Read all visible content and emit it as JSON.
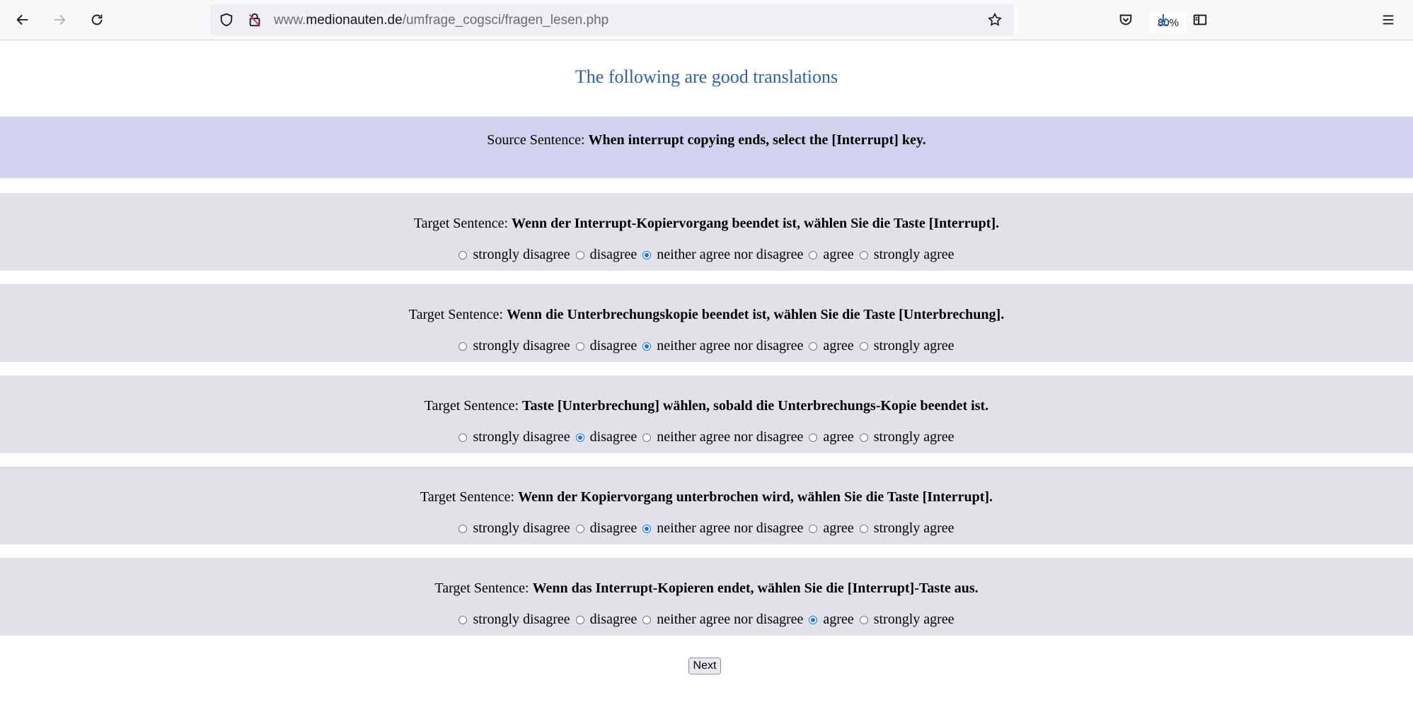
{
  "browser": {
    "url_prefix": "www.",
    "url_domain": "medionauten.de",
    "url_path": "/umfrage_cogsci/fragen_lesen.php",
    "zoom": "80%"
  },
  "page": {
    "title": "The following are good translations",
    "source_label": "Source Sentence:",
    "source_text": "When interrupt copying ends, select the [Interrupt] key.",
    "target_label": "Target Sentence:",
    "options": [
      "strongly disagree",
      "disagree",
      "neither agree nor disagree",
      "agree",
      "strongly agree"
    ],
    "targets": [
      {
        "text": "Wenn der Interrupt-Kopiervorgang beendet ist, wählen Sie die Taste [Interrupt].",
        "selected": "neither agree nor disagree"
      },
      {
        "text": "Wenn die Unterbrechungskopie beendet ist, wählen Sie die Taste [Unterbrechung].",
        "selected": "neither agree nor disagree"
      },
      {
        "text": "Taste [Unterbrechung] wählen, sobald die Unterbrechungs-Kopie beendet ist.",
        "selected": "disagree"
      },
      {
        "text": "Wenn der Kopiervorgang unterbrochen wird, wählen Sie die Taste [Interrupt].",
        "selected": "neither agree nor disagree"
      },
      {
        "text": "Wenn das Interrupt-Kopieren endet, wählen Sie die [Interrupt]-Taste aus.",
        "selected": "agree"
      }
    ],
    "next_label": "Next"
  }
}
